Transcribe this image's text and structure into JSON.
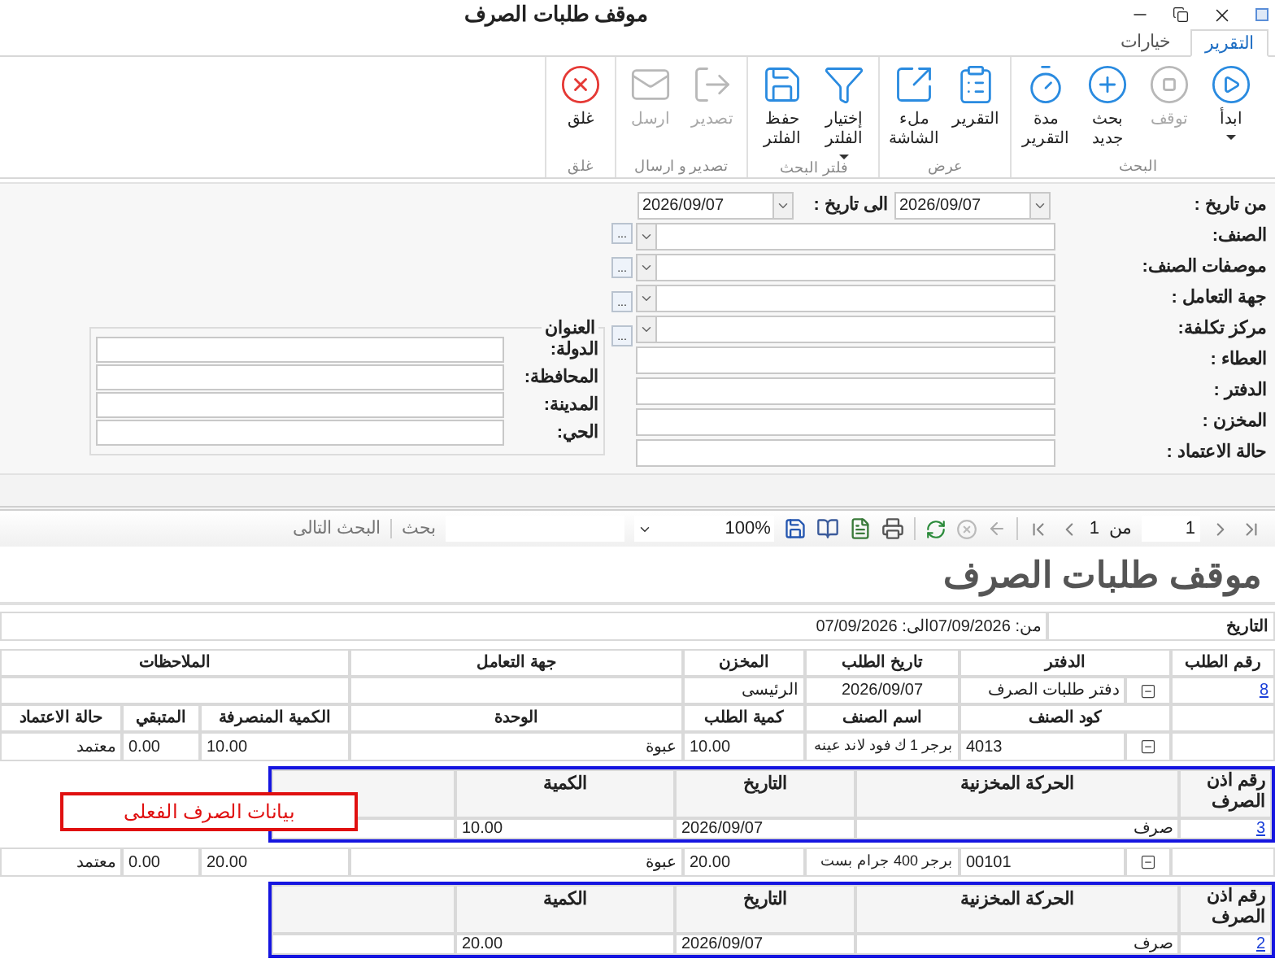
{
  "window": {
    "title": "موقف طلبات الصرف"
  },
  "tabs": [
    {
      "label": "التقرير",
      "selected": true
    },
    {
      "label": "خيارات",
      "selected": false
    }
  ],
  "ribbon": [
    {
      "label": "البحث",
      "buttons": [
        {
          "label": "ابدأ",
          "disabled": false,
          "dropdown": true
        },
        {
          "label": "توقف",
          "disabled": true,
          "dropdown": false
        },
        {
          "label": "بحث جديد",
          "disabled": false,
          "dropdown": false
        },
        {
          "label": "مدة التقرير",
          "disabled": false,
          "dropdown": false
        }
      ]
    },
    {
      "label": "عرض",
      "buttons": [
        {
          "label": "التقرير",
          "disabled": false,
          "dropdown": false
        },
        {
          "label": "ملء الشاشة",
          "disabled": false,
          "dropdown": false
        }
      ]
    },
    {
      "label": "فلتر البحث",
      "buttons": [
        {
          "label": "إختيار الفلتر",
          "disabled": false,
          "dropdown": true
        },
        {
          "label": "حفظ الفلتر",
          "disabled": false,
          "dropdown": false
        }
      ]
    },
    {
      "label": "تصدير و ارسال",
      "buttons": [
        {
          "label": "تصدير",
          "disabled": true,
          "dropdown": false
        },
        {
          "label": "ارسل",
          "disabled": true,
          "dropdown": false
        }
      ]
    },
    {
      "label": "غلق",
      "buttons": [
        {
          "label": "غلق",
          "disabled": false,
          "dropdown": false
        }
      ]
    }
  ],
  "filters": {
    "from_label": "من تاريخ :",
    "from_date": "2026/09/07",
    "to_label": "الى تاريخ :",
    "to_date": "2026/09/07",
    "fields": [
      {
        "label": "الصنف:",
        "kind": "lookup",
        "button": "..."
      },
      {
        "label": "موصفات الصنف:",
        "kind": "lookup",
        "button": "..."
      },
      {
        "label": "جهة التعامل :",
        "kind": "lookup",
        "button": "..."
      },
      {
        "label": "مركز تكلفة:",
        "kind": "lookup",
        "button": "..."
      },
      {
        "label": "العطاء :",
        "kind": "text"
      },
      {
        "label": "الدفتر :",
        "kind": "text"
      },
      {
        "label": "المخزن :",
        "kind": "text"
      },
      {
        "label": "حالة الاعتماد :",
        "kind": "text"
      }
    ],
    "address": {
      "title": "العنوان",
      "fields": [
        "الدولة:",
        "المحافظة:",
        "المدينة:",
        "الحي:"
      ]
    }
  },
  "report_toolbar": {
    "page": "1",
    "of_label": "من",
    "page_count": "1",
    "zoom": "100%",
    "find_label": "بحث",
    "next_label": "البحث التالى"
  },
  "report": {
    "title": "موقف طلبات الصرف",
    "date_label": "التاريخ",
    "date_value": "من: 07/09/2026الى: 07/09/2026",
    "order_columns": [
      "رقم الطلب",
      "الدفتر",
      "تاريخ الطلب",
      "المخزن",
      "جهة التعامل",
      "الملاحظات"
    ],
    "item_columns": [
      "كود الصنف",
      "اسم الصنف",
      "كمية الطلب",
      "الوحدة",
      "الكمية المنصرفة",
      "المتبقي",
      "حالة الاعتماد"
    ],
    "orders": [
      {
        "number": "8",
        "expanded": true,
        "cells": [
          "دفتر طلبات الصرف",
          "2026/09/07",
          "الرئيسى"
        ],
        "items": [
          {
            "code": "4013",
            "expanded": true,
            "cells": [
              "برجر 1 ك فود لاند عينه",
              "10.00",
              "عبوة",
              "10.00",
              "0.00",
              "معتمد"
            ],
            "issues": {
              "columns": [
                "رقم اذن الصرف",
                "الحركة المخزنية",
                "التاريخ",
                "الكمية"
              ],
              "rows": [
                {
                  "number": "3",
                  "cells": [
                    "صرف",
                    "2026/09/07",
                    "10.00"
                  ]
                }
              ]
            }
          },
          {
            "code": "00101",
            "expanded": true,
            "cells": [
              "برجر 400 جرام بست",
              "20.00",
              "عبوة",
              "20.00",
              "0.00",
              "معتمد"
            ],
            "issues": {
              "columns": [
                "رقم اذن الصرف",
                "الحركة المخزنية",
                "التاريخ",
                "الكمية"
              ],
              "rows": [
                {
                  "number": "2",
                  "cells": [
                    "صرف",
                    "2026/09/07",
                    "20.00"
                  ]
                }
              ]
            }
          }
        ]
      }
    ]
  },
  "annotation": {
    "text": "بيانات الصرف الفعلى"
  }
}
